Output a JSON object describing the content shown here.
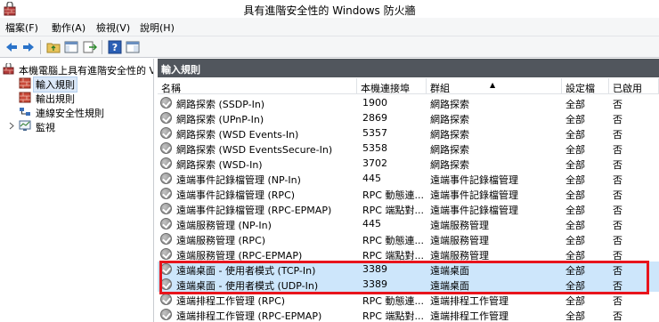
{
  "window": {
    "title": "具有進階安全性的 Windows 防火牆"
  },
  "menu": [
    {
      "label": "檔案(F)"
    },
    {
      "label": "動作(A)"
    },
    {
      "label": "檢視(V)"
    },
    {
      "label": "說明(H)"
    }
  ],
  "toolbar": {
    "icons": [
      "back-arrow-icon",
      "forward-arrow-icon",
      "folder-up-icon",
      "show-hide-tree-icon",
      "export-list-icon",
      "help-icon",
      "properties-icon"
    ]
  },
  "tree": {
    "root": "本機電腦上具有進階安全性的 V",
    "items": [
      {
        "label": "輸入規則",
        "selected": true
      },
      {
        "label": "輸出規則"
      },
      {
        "label": "連線安全性規則"
      },
      {
        "label": "監視"
      }
    ]
  },
  "main": {
    "header": "輸入規則",
    "columns": {
      "name": "名稱",
      "port": "本機連接埠",
      "group": "群組",
      "profile": "設定檔",
      "enabled": "已啟用"
    },
    "rows": [
      {
        "name": "網路探索 (SSDP-In)",
        "port": "1900",
        "group": "網路探索",
        "profile": "全部",
        "enabled": "否"
      },
      {
        "name": "網路探索 (UPnP-In)",
        "port": "2869",
        "group": "網路探索",
        "profile": "全部",
        "enabled": "否"
      },
      {
        "name": "網路探索 (WSD Events-In)",
        "port": "5357",
        "group": "網路探索",
        "profile": "全部",
        "enabled": "否"
      },
      {
        "name": "網路探索 (WSD EventsSecure-In)",
        "port": "5358",
        "group": "網路探索",
        "profile": "全部",
        "enabled": "否"
      },
      {
        "name": "網路探索 (WSD-In)",
        "port": "3702",
        "group": "網路探索",
        "profile": "全部",
        "enabled": "否"
      },
      {
        "name": "遠端事件記錄檔管理 (NP-In)",
        "port": "445",
        "group": "遠端事件記錄檔管理",
        "profile": "全部",
        "enabled": "否"
      },
      {
        "name": "遠端事件記錄檔管理 (RPC)",
        "port": "RPC 動態連...",
        "group": "遠端事件記錄檔管理",
        "profile": "全部",
        "enabled": "否"
      },
      {
        "name": "遠端事件記錄檔管理 (RPC-EPMAP)",
        "port": "RPC 端點對...",
        "group": "遠端事件記錄檔管理",
        "profile": "全部",
        "enabled": "否"
      },
      {
        "name": "遠端服務管理 (NP-In)",
        "port": "445",
        "group": "遠端服務管理",
        "profile": "全部",
        "enabled": "否"
      },
      {
        "name": "遠端服務管理 (RPC)",
        "port": "RPC 動態連...",
        "group": "遠端服務管理",
        "profile": "全部",
        "enabled": "否"
      },
      {
        "name": "遠端服務管理 (RPC-EPMAP)",
        "port": "RPC 端點對...",
        "group": "遠端服務管理",
        "profile": "全部",
        "enabled": "否"
      },
      {
        "name": "遠端桌面 - 使用者模式 (TCP-In)",
        "port": "3389",
        "group": "遠端桌面",
        "profile": "全部",
        "enabled": "否"
      },
      {
        "name": "遠端桌面 - 使用者模式 (UDP-In)",
        "port": "3389",
        "group": "遠端桌面",
        "profile": "全部",
        "enabled": "否"
      },
      {
        "name": "遠端排程工作管理 (RPC)",
        "port": "RPC 動態連...",
        "group": "遠端排程工作管理",
        "profile": "全部",
        "enabled": "否"
      },
      {
        "name": "遠端排程工作管理 (RPC-EPMAP)",
        "port": "RPC 端點對...",
        "group": "遠端排程工作管理",
        "profile": "全部",
        "enabled": "否"
      }
    ]
  },
  "colors": {
    "header_bg": "#51565d",
    "highlight_box": "#e8141c",
    "selected_row": "#cde6fb"
  }
}
